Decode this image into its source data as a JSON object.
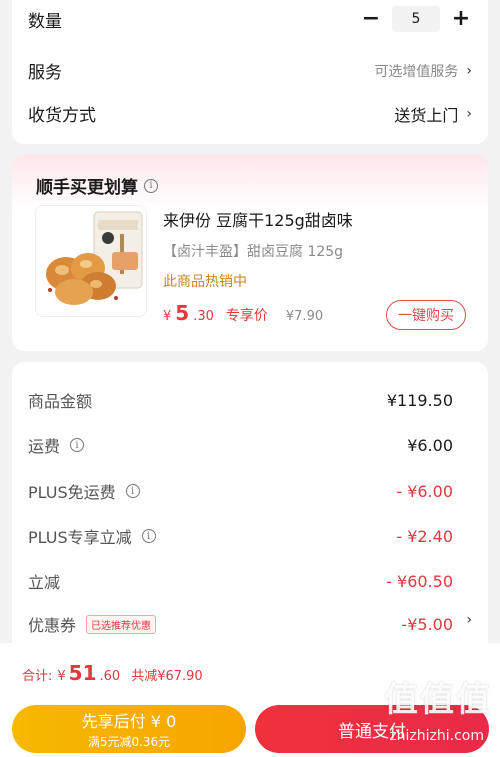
{
  "order": {
    "quantity_label": "数量",
    "quantity_minus": "−",
    "quantity_value": "5",
    "quantity_plus": "+",
    "service_label": "服务",
    "service_value": "可选增值服务",
    "delivery_label": "收货方式",
    "delivery_value": "送货上门",
    "chevron": "›"
  },
  "recommend": {
    "title": "顺手买更划算",
    "info_icon": "info-icon",
    "product": {
      "name": "来伊份 豆腐干125g甜卤味",
      "subtitle": "【卤汁丰盈】甜卤豆腐 125g",
      "hot_text": "此商品热销中",
      "price_yen": "¥",
      "price_int": "5",
      "price_dec": ".30",
      "price_tag": "专享价",
      "original_price": "¥7.90",
      "buy_label": "一键购买"
    }
  },
  "amounts": {
    "rows": [
      {
        "label": "商品金额",
        "value": "¥119.50"
      },
      {
        "label": "运费",
        "value": "¥6.00"
      },
      {
        "label": "PLUS免运费",
        "value": "- ¥6.00"
      },
      {
        "label": "PLUS专享立减",
        "value": "- ¥2.40"
      },
      {
        "label": "立减",
        "value": "- ¥60.50"
      },
      {
        "label": "优惠券",
        "badge": "已选推荐优惠",
        "value": "-¥5.00"
      }
    ]
  },
  "footer": {
    "total_label": "合计:",
    "total_yen": "¥",
    "total_int": "51",
    "total_dec": ".60",
    "total_save": "共减¥67.90",
    "pay_later_line1": "先享后付 ¥ 0",
    "pay_later_line2": "满5元减0.36元",
    "pay_normal": "普通支付"
  },
  "watermark": {
    "big": "值值值",
    "small": "zhizhizhi.com"
  },
  "colors": {
    "accent_red": "#e0393e",
    "gold": "#f6b800",
    "hot_orange": "#c8861d"
  }
}
